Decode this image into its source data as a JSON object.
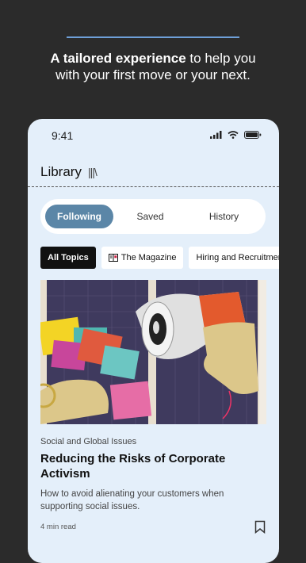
{
  "promo": {
    "headline_bold": "A tailored experience",
    "headline_rest_line1": " to help you",
    "headline_line2": "with your first move or your next."
  },
  "status": {
    "time": "9:41"
  },
  "library": {
    "title": "Library",
    "books_icon": "books-icon",
    "tabs": [
      {
        "label": "Following",
        "active": true
      },
      {
        "label": "Saved",
        "active": false
      },
      {
        "label": "History",
        "active": false
      }
    ],
    "chips": [
      {
        "label": "All Topics",
        "active": true
      },
      {
        "label": "The Magazine",
        "icon": "magazine-icon"
      },
      {
        "label": "Hiring and Recruitment"
      }
    ]
  },
  "article": {
    "category": "Social and Global Issues",
    "title": "Reducing the Risks of Corporate Activism",
    "description": "How to avoid alienating your customers when supporting social issues.",
    "read_time": "4 min read"
  },
  "colors": {
    "accent": "#5b86a7",
    "line": "#6e9fd8"
  }
}
